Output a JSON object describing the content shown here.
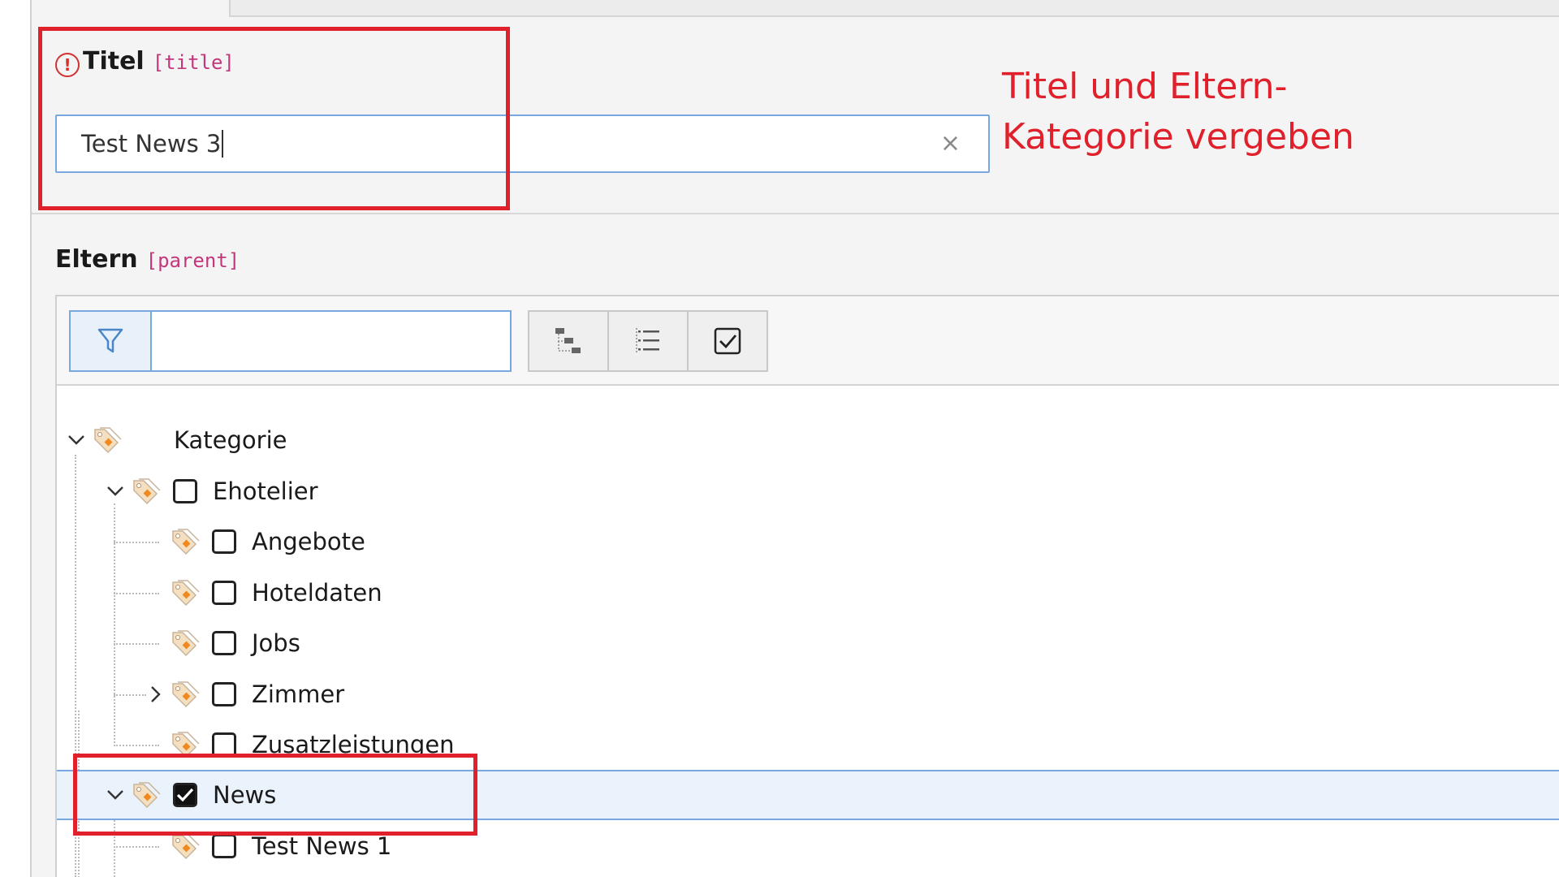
{
  "title_field": {
    "label": "Titel",
    "code": "[title]",
    "required_icon": "exclamation-circle-icon",
    "value": "Test News 3",
    "clear_label": "×"
  },
  "annotation": {
    "text_line1": "Titel und Eltern-",
    "text_line2": "Kategorie vergeben",
    "color": "#e0202a"
  },
  "parent_field": {
    "label": "Eltern",
    "code": "[parent]",
    "filter_placeholder": "",
    "toolbar_icons": [
      "filter-icon",
      "tree-expand-icon",
      "list-icon",
      "checkbox-icon"
    ]
  },
  "tree": {
    "root": {
      "label": "Kategorie",
      "expanded": true
    },
    "nodes": [
      {
        "label": "Ehotelier",
        "checked": false,
        "expanded": true,
        "level": 1
      },
      {
        "label": "Angebote",
        "checked": false,
        "level": 2
      },
      {
        "label": "Hoteldaten",
        "checked": false,
        "level": 2
      },
      {
        "label": "Jobs",
        "checked": false,
        "level": 2
      },
      {
        "label": "Zimmer",
        "checked": false,
        "collapsed": true,
        "level": 2
      },
      {
        "label": "Zusatzleistungen",
        "checked": false,
        "level": 2
      },
      {
        "label": "News",
        "checked": true,
        "expanded": true,
        "selected": true,
        "level": 1
      },
      {
        "label": "Test News 1",
        "checked": false,
        "level": 2
      }
    ]
  },
  "colors": {
    "accent": "#79a8e0",
    "field_code": "#c3377c",
    "required": "#d43030",
    "tag_icon": "#f0a030"
  }
}
